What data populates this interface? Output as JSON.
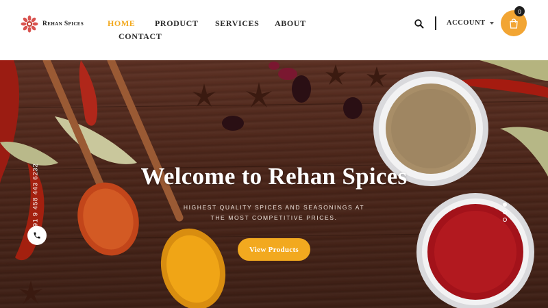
{
  "brand": {
    "name": "Rehan Spices"
  },
  "nav": {
    "items": [
      "HOME",
      "PRODUCT",
      "SERVICES",
      "ABOUT",
      "CONTACT"
    ],
    "active": "HOME"
  },
  "header": {
    "account_label": "ACCOUNT",
    "cart_count": "0",
    "icons": [
      "search-icon",
      "chevron-down-icon",
      "shopping-bag-icon"
    ]
  },
  "hero": {
    "title": "Welcome to Rehan Spices",
    "subtitle_line1": "HIGHEST QUALITY SPICES AND SEASONINGS AT",
    "subtitle_line2": "THE MOST COMPETITIVE PRICES.",
    "cta_label": "View Products",
    "phone": "+91 9 458 443 6232",
    "slide_count": 3,
    "active_slide": 1
  },
  "colors": {
    "accent": "#f2a91f",
    "cart": "#f2a533",
    "text": "#2b2b2b",
    "hero_wood": "#4a2519"
  }
}
